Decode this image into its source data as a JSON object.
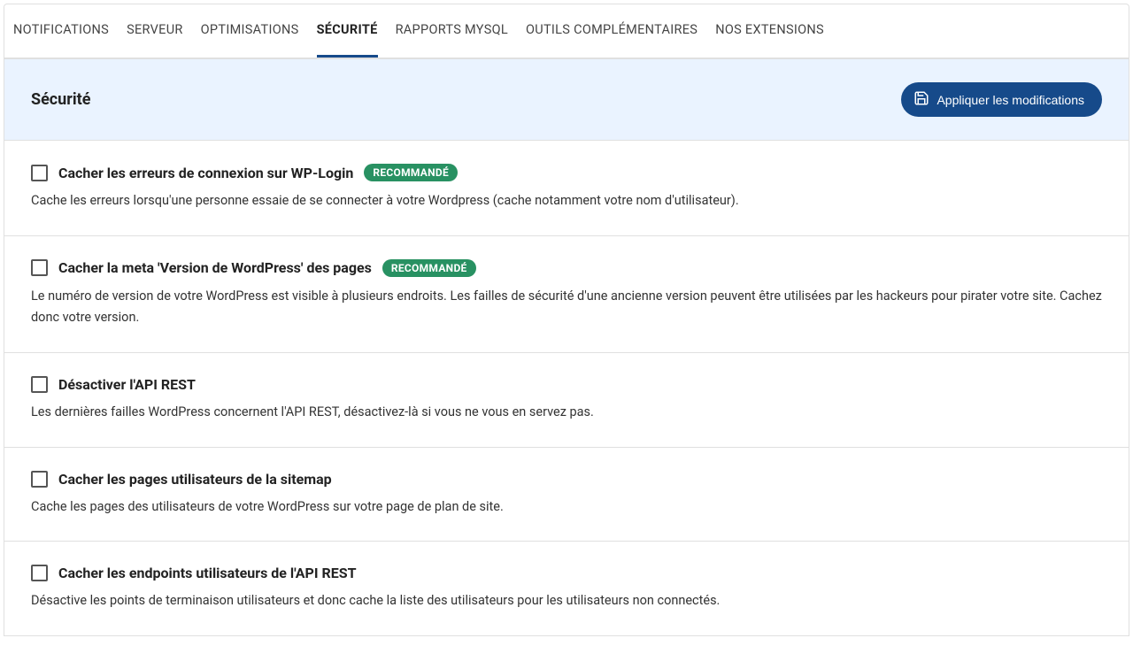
{
  "tabs": [
    {
      "label": "NOTIFICATIONS",
      "active": false
    },
    {
      "label": "SERVEUR",
      "active": false
    },
    {
      "label": "OPTIMISATIONS",
      "active": false
    },
    {
      "label": "SÉCURITÉ",
      "active": true
    },
    {
      "label": "RAPPORTS MYSQL",
      "active": false
    },
    {
      "label": "OUTILS COMPLÉMENTAIRES",
      "active": false
    },
    {
      "label": "NOS EXTENSIONS",
      "active": false
    }
  ],
  "section": {
    "title": "Sécurité",
    "apply_label": "Appliquer les modifications"
  },
  "badge_text": "RECOMMANDÉ",
  "options": [
    {
      "title": "Cacher les erreurs de connexion sur WP-Login",
      "recommended": true,
      "description": "Cache les erreurs lorsqu'une personne essaie de se connecter à votre Wordpress (cache notamment votre nom d'utilisateur)."
    },
    {
      "title": "Cacher la meta 'Version de WordPress' des pages",
      "recommended": true,
      "description": "Le numéro de version de votre WordPress est visible à plusieurs endroits. Les failles de sécurité d'une ancienne version peuvent être utilisées par les hackeurs pour pirater votre site. Cachez donc votre version."
    },
    {
      "title": "Désactiver l'API REST",
      "recommended": false,
      "description": "Les dernières failles WordPress concernent l'API REST, désactivez-là si vous ne vous en servez pas."
    },
    {
      "title": "Cacher les pages utilisateurs de la sitemap",
      "recommended": false,
      "description": "Cache les pages des utilisateurs de votre WordPress sur votre page de plan de site."
    },
    {
      "title": "Cacher les endpoints utilisateurs de l'API REST",
      "recommended": false,
      "description": "Désactive les points de terminaison utilisateurs et donc cache la liste des utilisateurs pour les utilisateurs non connectés."
    }
  ]
}
